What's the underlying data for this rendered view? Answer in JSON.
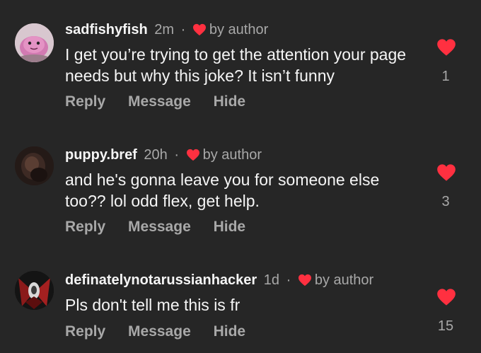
{
  "comments": [
    {
      "username": "sadfishyfish",
      "time": "2m",
      "liked_by_label": "by author",
      "text": "I get you’re trying to get the attention your page needs but why this joke? It isn’t funny",
      "like_count": "1",
      "avatar_icon": "pink-plush-avatar"
    },
    {
      "username": "puppy.bref",
      "time": "20h",
      "liked_by_label": "by author",
      "text": "and he's gonna leave you for someone else too?? lol odd flex, get help.",
      "like_count": "3",
      "avatar_icon": "dark-photo-avatar"
    },
    {
      "username": "definatelynotarussianhacker",
      "time": "1d",
      "liked_by_label": "by author",
      "text": "Pls don't tell me this is fr",
      "like_count": "15",
      "avatar_icon": "red-dark-art-avatar"
    }
  ],
  "actions": {
    "reply": "Reply",
    "message": "Message",
    "hide": "Hide"
  },
  "separator": "·",
  "colors": {
    "heart": "#ff3040",
    "background": "#262626",
    "secondary_text": "#a8a8a8"
  }
}
